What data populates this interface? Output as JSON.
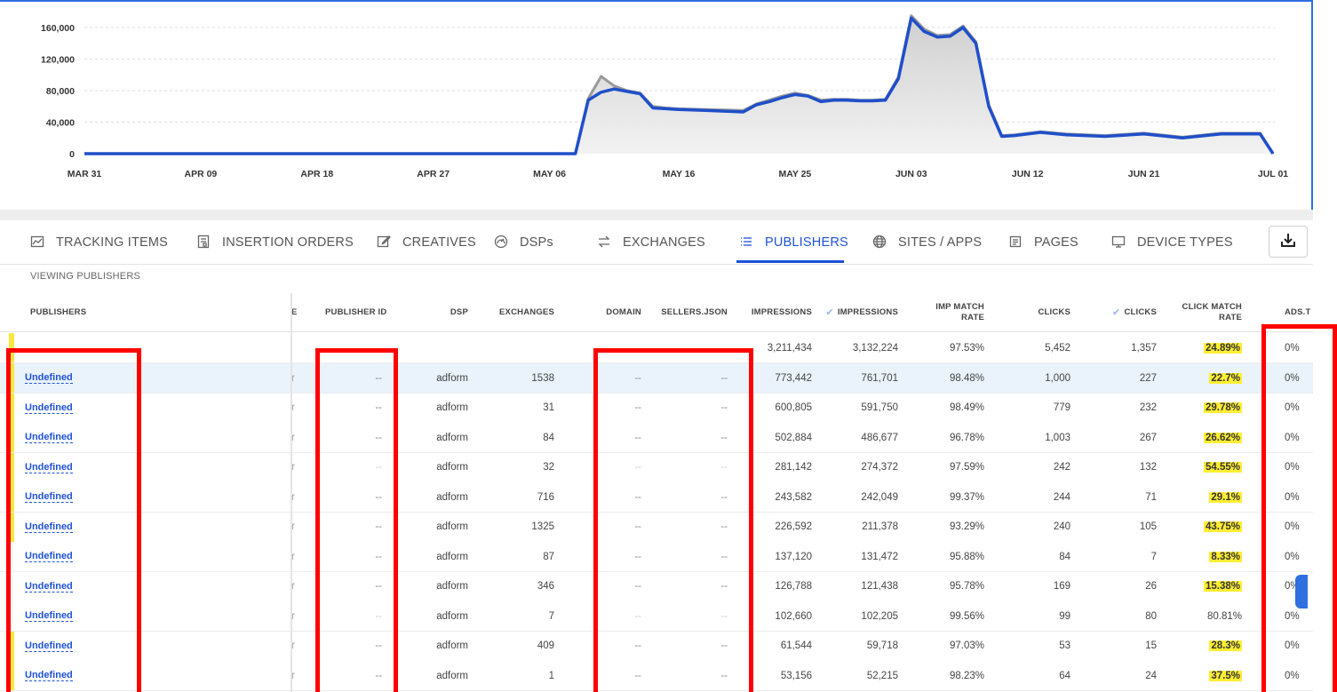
{
  "chart_data": {
    "type": "area",
    "x_ticks": [
      "MAR 31",
      "APR 09",
      "APR 18",
      "APR 27",
      "MAY 06",
      "MAY 16",
      "MAY 25",
      "JUN 03",
      "JUN 12",
      "JUN 21",
      "JUL 01"
    ],
    "y_ticks": [
      "160,000",
      "120,000",
      "80,000",
      "40,000",
      "0"
    ],
    "ylim": [
      0,
      160000
    ],
    "grid": true,
    "series": [
      {
        "color": "#1f4fc9",
        "x": [
          "Mar 31",
          "May 08",
          "May 09",
          "May 10",
          "May 11",
          "May 12",
          "May 13",
          "May 14",
          "May 15",
          "May 16",
          "May 18",
          "May 21",
          "May 22",
          "May 23",
          "May 24",
          "May 25",
          "May 26",
          "May 27",
          "May 28",
          "May 29",
          "May 30",
          "May 31",
          "Jun 01",
          "Jun 02",
          "Jun 03",
          "Jun 04",
          "Jun 05",
          "Jun 06",
          "Jun 07",
          "Jun 08",
          "Jun 09",
          "Jun 10",
          "Jun 11",
          "Jun 13",
          "Jun 15",
          "Jun 18",
          "Jun 21",
          "Jun 24",
          "Jun 27",
          "Jun 30",
          "Jul 01"
        ],
        "values": [
          0,
          0,
          68000,
          78000,
          82000,
          79000,
          76000,
          58000,
          57000,
          56000,
          55000,
          53000,
          62000,
          66000,
          71000,
          75000,
          73000,
          66000,
          68000,
          68000,
          67000,
          67000,
          68000,
          95000,
          172000,
          155000,
          148000,
          149000,
          160000,
          140000,
          60000,
          22000,
          23000,
          27000,
          24000,
          22000,
          25000,
          20000,
          25000,
          25000,
          0
        ]
      },
      {
        "color": "#9a9a9a",
        "x": [
          "Mar 31",
          "May 08",
          "May 09",
          "May 10",
          "May 11",
          "May 12",
          "May 13",
          "May 14",
          "May 15",
          "May 16",
          "May 18",
          "May 21",
          "May 22",
          "May 23",
          "May 24",
          "May 25",
          "May 26",
          "May 27",
          "May 28",
          "May 29",
          "May 30",
          "May 31",
          "Jun 01",
          "Jun 02",
          "Jun 03",
          "Jun 04",
          "Jun 05",
          "Jun 06",
          "Jun 07",
          "Jun 08",
          "Jun 09",
          "Jun 10",
          "Jun 11",
          "Jun 13",
          "Jun 15",
          "Jun 18",
          "Jun 21",
          "Jun 24",
          "Jun 27",
          "Jun 30",
          "Jul 01"
        ],
        "values": [
          0,
          0,
          70000,
          98000,
          86000,
          80000,
          77000,
          60000,
          58000,
          57000,
          56000,
          55000,
          63000,
          68000,
          73000,
          77000,
          74000,
          68000,
          69000,
          69000,
          68000,
          68000,
          69000,
          97000,
          175000,
          158000,
          150000,
          151000,
          162000,
          142000,
          62000,
          23000,
          24000,
          28000,
          25000,
          23000,
          26000,
          21000,
          26000,
          26000,
          0
        ]
      }
    ]
  },
  "tabs": [
    {
      "label": "TRACKING ITEMS",
      "icon": "chart-icon"
    },
    {
      "label": "INSERTION ORDERS",
      "icon": "document-icon"
    },
    {
      "label": "CREATIVES",
      "icon": "edit-icon"
    },
    {
      "label": "DSPs",
      "icon": "gauge-icon"
    },
    {
      "label": "EXCHANGES",
      "icon": "exchange-icon"
    },
    {
      "label": "PUBLISHERS",
      "icon": "list-icon"
    },
    {
      "label": "SITES / APPS",
      "icon": "globe-icon"
    },
    {
      "label": "PAGES",
      "icon": "page-icon"
    },
    {
      "label": "DEVICE TYPES",
      "icon": "monitor-icon"
    }
  ],
  "active_tab": "PUBLISHERS",
  "viewing_label": "VIEWING PUBLISHERS",
  "columns": {
    "publishers": "PUBLISHERS",
    "e_trunc": "E",
    "publisher_id": "PUBLISHER ID",
    "dsp": "DSP",
    "exchanges": "EXCHANGES",
    "domain": "DOMAIN",
    "sellers_json": "SELLERS.JSON",
    "impressions": "IMPRESSIONS",
    "verified_impressions": "IMPRESSIONS",
    "imp_match_rate": "IMP MATCH RATE",
    "clicks": "CLICKS",
    "verified_clicks": "CLICKS",
    "click_match_rate": "CLICK MATCH RATE",
    "ads": "ADS.T"
  },
  "totals": {
    "impressions": "3,211,434",
    "verified_impressions": "3,132,224",
    "imp_match_rate": "97.53%",
    "clicks": "5,452",
    "verified_clicks": "1,357",
    "click_match_rate": "24.89%",
    "ads": "0%"
  },
  "rows": [
    {
      "publisher": "Undefined",
      "e": "r",
      "publisher_id": "--",
      "dsp": "adform",
      "exchanges": "1538",
      "domain": "--",
      "sellers_json": "--",
      "impressions": "773,442",
      "verified_impressions": "761,701",
      "imp_match_rate": "98.48%",
      "clicks": "1,000",
      "verified_clicks": "227",
      "click_match_rate": "22.7%",
      "ads": "0%"
    },
    {
      "publisher": "Undefined",
      "e": "r",
      "publisher_id": "--",
      "dsp": "adform",
      "exchanges": "31",
      "domain": "--",
      "sellers_json": "--",
      "impressions": "600,805",
      "verified_impressions": "591,750",
      "imp_match_rate": "98.49%",
      "clicks": "779",
      "verified_clicks": "232",
      "click_match_rate": "29.78%",
      "ads": "0%"
    },
    {
      "publisher": "Undefined",
      "e": "r",
      "publisher_id": "--",
      "dsp": "adform",
      "exchanges": "84",
      "domain": "--",
      "sellers_json": "--",
      "impressions": "502,884",
      "verified_impressions": "486,677",
      "imp_match_rate": "96.78%",
      "clicks": "1,003",
      "verified_clicks": "267",
      "click_match_rate": "26.62%",
      "ads": "0%"
    },
    {
      "publisher": "Undefined",
      "e": "r",
      "publisher_id": "--",
      "dsp": "adform",
      "exchanges": "32",
      "domain": "--",
      "sellers_json": "--",
      "impressions": "281,142",
      "verified_impressions": "274,372",
      "imp_match_rate": "97.59%",
      "clicks": "242",
      "verified_clicks": "132",
      "click_match_rate": "54.55%",
      "ads": "0%"
    },
    {
      "publisher": "Undefined",
      "e": "r",
      "publisher_id": "--",
      "dsp": "adform",
      "exchanges": "716",
      "domain": "--",
      "sellers_json": "--",
      "impressions": "243,582",
      "verified_impressions": "242,049",
      "imp_match_rate": "99.37%",
      "clicks": "244",
      "verified_clicks": "71",
      "click_match_rate": "29.1%",
      "ads": "0%"
    },
    {
      "publisher": "Undefined",
      "e": "r",
      "publisher_id": "--",
      "dsp": "adform",
      "exchanges": "1325",
      "domain": "--",
      "sellers_json": "--",
      "impressions": "226,592",
      "verified_impressions": "211,378",
      "imp_match_rate": "93.29%",
      "clicks": "240",
      "verified_clicks": "105",
      "click_match_rate": "43.75%",
      "ads": "0%"
    },
    {
      "publisher": "Undefined",
      "e": "r",
      "publisher_id": "--",
      "dsp": "adform",
      "exchanges": "87",
      "domain": "--",
      "sellers_json": "--",
      "impressions": "137,120",
      "verified_impressions": "131,472",
      "imp_match_rate": "95.88%",
      "clicks": "84",
      "verified_clicks": "7",
      "click_match_rate": "8.33%",
      "ads": "0%"
    },
    {
      "publisher": "Undefined",
      "e": "r",
      "publisher_id": "--",
      "dsp": "adform",
      "exchanges": "346",
      "domain": "--",
      "sellers_json": "--",
      "impressions": "126,788",
      "verified_impressions": "121,438",
      "imp_match_rate": "95.78%",
      "clicks": "169",
      "verified_clicks": "26",
      "click_match_rate": "15.38%",
      "ads": "0%"
    },
    {
      "publisher": "Undefined",
      "e": "r",
      "publisher_id": "--",
      "dsp": "adform",
      "exchanges": "7",
      "domain": "--",
      "sellers_json": "--",
      "impressions": "102,660",
      "verified_impressions": "102,205",
      "imp_match_rate": "99.56%",
      "clicks": "99",
      "verified_clicks": "80",
      "click_match_rate": "80.81%",
      "ads": "0%"
    },
    {
      "publisher": "Undefined",
      "e": "r",
      "publisher_id": "--",
      "dsp": "adform",
      "exchanges": "409",
      "domain": "--",
      "sellers_json": "--",
      "impressions": "61,544",
      "verified_impressions": "59,718",
      "imp_match_rate": "97.03%",
      "clicks": "53",
      "verified_clicks": "15",
      "click_match_rate": "28.3%",
      "ads": "0%"
    },
    {
      "publisher": "Undefined",
      "e": "r",
      "publisher_id": "--",
      "dsp": "adform",
      "exchanges": "1",
      "domain": "--",
      "sellers_json": "--",
      "impressions": "53,156",
      "verified_impressions": "52,215",
      "imp_match_rate": "98.23%",
      "clicks": "64",
      "verified_clicks": "24",
      "click_match_rate": "37.5%",
      "ads": "0%"
    }
  ]
}
